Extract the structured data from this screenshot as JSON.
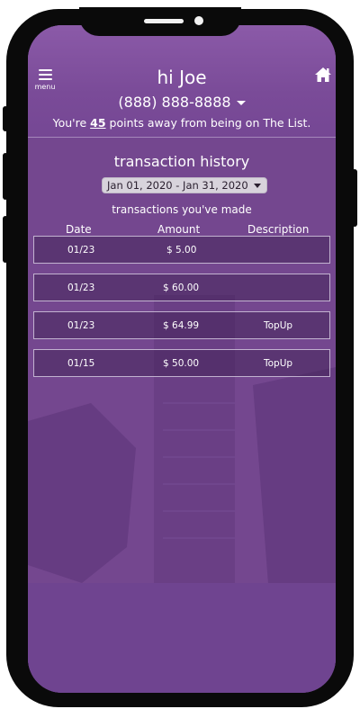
{
  "header": {
    "menu_label": "menu",
    "greeting": "hi Joe",
    "phone": "(888) 888-8888",
    "points_prefix": "You're",
    "points_value": "45",
    "points_suffix": "points away from being on The List."
  },
  "history": {
    "title": "transaction history",
    "date_range": "Jan 01, 2020 - Jan 31, 2020",
    "subtitle": "transactions you've made",
    "columns": [
      "Date",
      "Amount",
      "Description"
    ],
    "rows": [
      {
        "date": "01/23",
        "amount": "$ 5.00",
        "description": ""
      },
      {
        "date": "01/23",
        "amount": "$ 60.00",
        "description": ""
      },
      {
        "date": "01/23",
        "amount": "$ 64.99",
        "description": "TopUp"
      },
      {
        "date": "01/15",
        "amount": "$ 50.00",
        "description": "TopUp"
      }
    ]
  },
  "icons": {
    "menu": "hamburger-icon",
    "home": "home-icon",
    "phone_dropdown": "caret-down-icon"
  },
  "colors": {
    "accent": "#74478f",
    "header": "#8b5aa8",
    "frame": "#0a0a0a"
  }
}
